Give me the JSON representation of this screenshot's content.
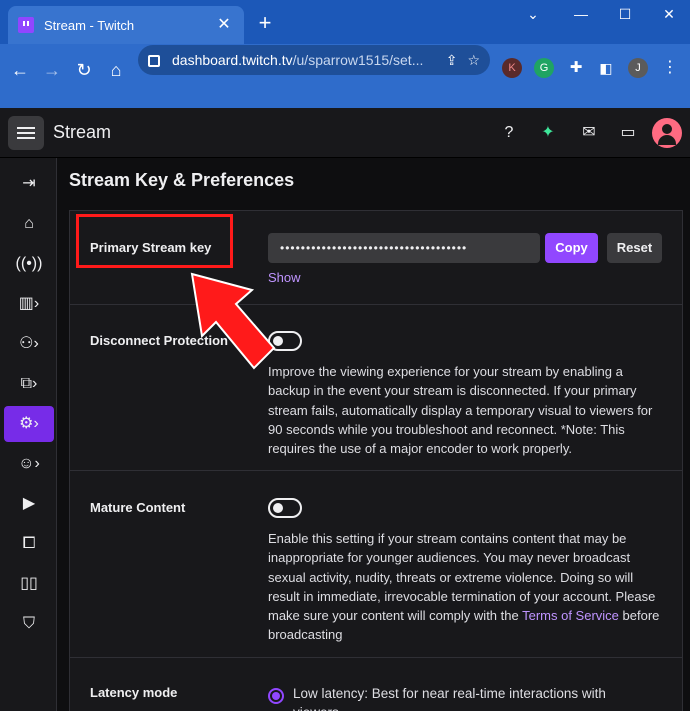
{
  "browser": {
    "tab_title": "Stream - Twitch",
    "tab_close": "✕",
    "new_tab": "+",
    "url_host": "dashboard.twitch.tv",
    "url_path": "/u/sparrow1515/set...",
    "ext_k": "K",
    "ext_g": "G",
    "profile_initial": "J"
  },
  "header": {
    "title": "Stream"
  },
  "page": {
    "title": "Stream Key & Preferences"
  },
  "stream_key": {
    "label": "Primary Stream key",
    "masked_value": "••••••••••••••••••••••••••••••••••••",
    "copy_label": "Copy",
    "reset_label": "Reset",
    "show_label": "Show"
  },
  "disconnect_protection": {
    "label": "Disconnect Protection",
    "description": "Improve the viewing experience for your stream by enabling a backup in the event your stream is disconnected. If your primary stream fails, automatically display a temporary visual to viewers for 90 seconds while you troubleshoot and reconnect. *Note: This requires the use of a major encoder to work properly.",
    "enabled": false
  },
  "mature_content": {
    "label": "Mature Content",
    "description_1": "Enable this setting if your stream contains content that may be inappropriate for younger audiences. You may never broadcast sexual activity, nudity, threats or extreme violence. Doing so will result in immediate, irrevocable termination of your account. Please make sure your content will comply with the ",
    "terms_link": "Terms of Service",
    "description_2": " before broadcasting",
    "enabled": false
  },
  "latency": {
    "label": "Latency mode",
    "option_low": "Low latency: Best for near real-time interactions with viewers"
  },
  "colors": {
    "accent": "#9147ff",
    "link": "#bf94ff",
    "annotation": "#ff1a1a"
  }
}
